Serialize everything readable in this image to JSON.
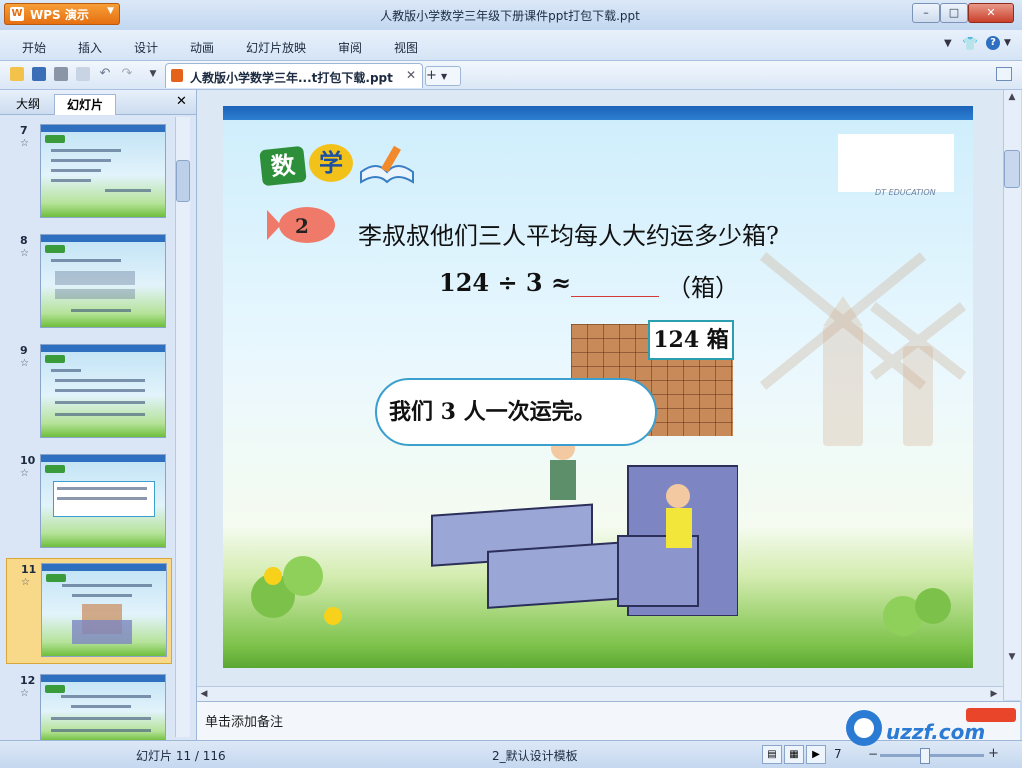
{
  "app": {
    "brand": "WPS 演示",
    "window_title": "人教版小学数学三年级下册课件ppt打包下载.ppt"
  },
  "menu": [
    "开始",
    "插入",
    "设计",
    "动画",
    "幻灯片放映",
    "审阅",
    "视图"
  ],
  "toolbar": {
    "doc_tab_label": "人教版小学数学三年...t打包下载.ppt",
    "new_tab_label": "+"
  },
  "left_panel": {
    "tabs": [
      "大纲",
      "幻灯片"
    ],
    "thumbnails": [
      {
        "num": "7",
        "star": "☆"
      },
      {
        "num": "8",
        "star": "☆"
      },
      {
        "num": "9",
        "star": "☆"
      },
      {
        "num": "10",
        "star": "☆"
      },
      {
        "num": "11",
        "star": "☆",
        "selected": true
      },
      {
        "num": "12",
        "star": "☆"
      }
    ]
  },
  "slide": {
    "badge_chars": [
      "数",
      "学"
    ],
    "edu_caption": "DT EDUCATION",
    "question_number": "2",
    "question": "李叔叔他们三人平均每人大约运多少箱?",
    "formula": "124 ÷ 3 ≈",
    "unit": "（箱）",
    "box_label": "124 箱",
    "speech": "我们 3 人一次运完。"
  },
  "notes": {
    "placeholder": "单击添加备注"
  },
  "status": {
    "slide_info": "幻灯片 11 / 116",
    "template": "2_默认设计模板",
    "zoom": "7"
  },
  "watermark": "uzzf.com",
  "colors": {
    "accent": "#e56d0f",
    "slide_header": "#1c63b8",
    "bubble_border": "#3a9fcf"
  }
}
